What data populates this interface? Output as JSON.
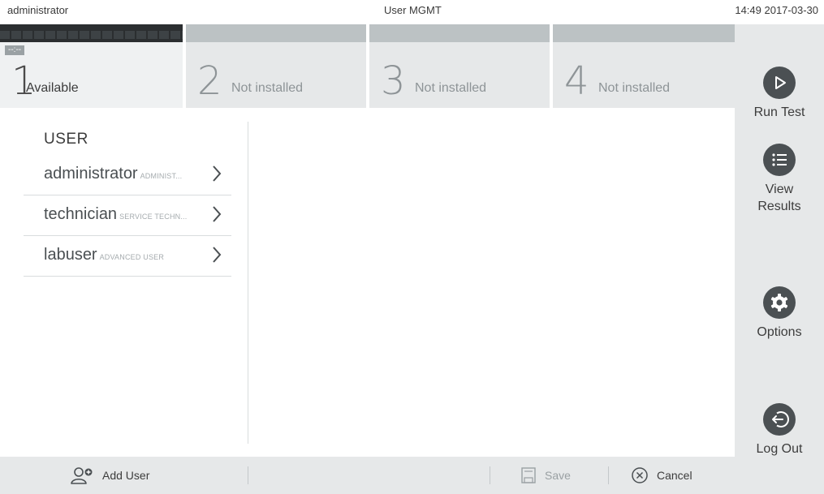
{
  "status_bar": {
    "user": "administrator",
    "screen_title": "User MGMT",
    "datetime": "14:49 2017-03-30"
  },
  "modules": [
    {
      "number": "1",
      "label": "Available",
      "indicator": "--:--",
      "active": true
    },
    {
      "number": "2",
      "label": "Not installed",
      "active": false
    },
    {
      "number": "3",
      "label": "Not installed",
      "active": false
    },
    {
      "number": "4",
      "label": "Not installed",
      "active": false
    }
  ],
  "user_list": {
    "heading": "USER",
    "users": [
      {
        "name": "administrator",
        "role": "ADMINIST..."
      },
      {
        "name": "technician",
        "role": "SERVICE TECHN..."
      },
      {
        "name": "labuser",
        "role": "ADVANCED USER"
      }
    ]
  },
  "sidebar": {
    "run_test": "Run Test",
    "view_results_line1": "View",
    "view_results_line2": "Results",
    "options": "Options",
    "log_out": "Log Out",
    "icons": [
      "play-icon",
      "list-icon",
      "gear-icon",
      "logout-icon"
    ]
  },
  "toolbar": {
    "add_user": "Add User",
    "save": "Save",
    "cancel": "Cancel"
  },
  "colors": {
    "sidebar_button": "#4b5053",
    "active_tab_bar": "#2b2e30",
    "inactive_tab_bar": "#bcc2c4",
    "panel_background": "#e6e8e9"
  }
}
